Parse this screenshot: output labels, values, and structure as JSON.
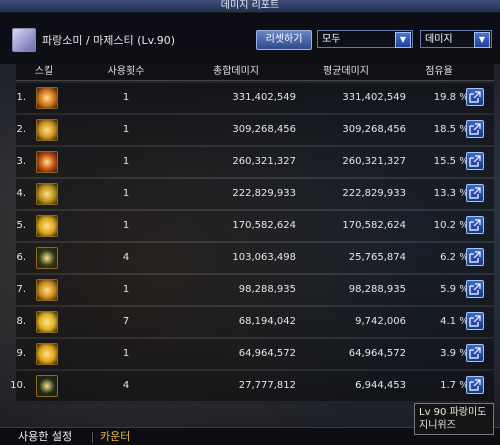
{
  "window": {
    "title": "데미지 리포트"
  },
  "header": {
    "player": "파랑소미 / 마제스티 (Lv.90)",
    "reset_label": "리셋하기",
    "filter1": "모두",
    "filter2": "데미지"
  },
  "table": {
    "columns": [
      "스킬",
      "사용횟수",
      "총합데미지",
      "평균데미지",
      "점유율"
    ],
    "rows": [
      {
        "index": "1.",
        "uses": "1",
        "total": "331,402,549",
        "avg": "331,402,549",
        "pct": "19.8",
        "color": "#d0701a"
      },
      {
        "index": "2.",
        "uses": "1",
        "total": "309,268,456",
        "avg": "309,268,456",
        "pct": "18.5",
        "color": "#c8901c"
      },
      {
        "index": "3.",
        "uses": "1",
        "total": "260,321,327",
        "avg": "260,321,327",
        "pct": "15.5",
        "color": "#c04a10"
      },
      {
        "index": "4.",
        "uses": "1",
        "total": "222,829,933",
        "avg": "222,829,933",
        "pct": "13.3",
        "color": "#b89018"
      },
      {
        "index": "5.",
        "uses": "1",
        "total": "170,582,624",
        "avg": "170,582,624",
        "pct": "10.2",
        "color": "#d8a21a"
      },
      {
        "index": "6.",
        "uses": "4",
        "total": "103,063,498",
        "avg": "25,765,874",
        "pct": "6.2",
        "color": "#2a3a18"
      },
      {
        "index": "7.",
        "uses": "1",
        "total": "98,288,935",
        "avg": "98,288,935",
        "pct": "5.9",
        "color": "#c88a18"
      },
      {
        "index": "8.",
        "uses": "7",
        "total": "68,194,042",
        "avg": "9,742,006",
        "pct": "4.1",
        "color": "#d8b020"
      },
      {
        "index": "9.",
        "uses": "1",
        "total": "64,964,572",
        "avg": "64,964,572",
        "pct": "3.9",
        "color": "#e0a018"
      },
      {
        "index": "10.",
        "uses": "4",
        "total": "27,777,812",
        "avg": "6,944,453",
        "pct": "1.7",
        "color": "#1a2a18"
      }
    ],
    "pct_sign": "%"
  },
  "tabs": {
    "skills": "사용한 설정",
    "counter": "카운터"
  },
  "tooltip": {
    "line1": "Lv 90 파랑미도",
    "line2": "지니위즈"
  }
}
